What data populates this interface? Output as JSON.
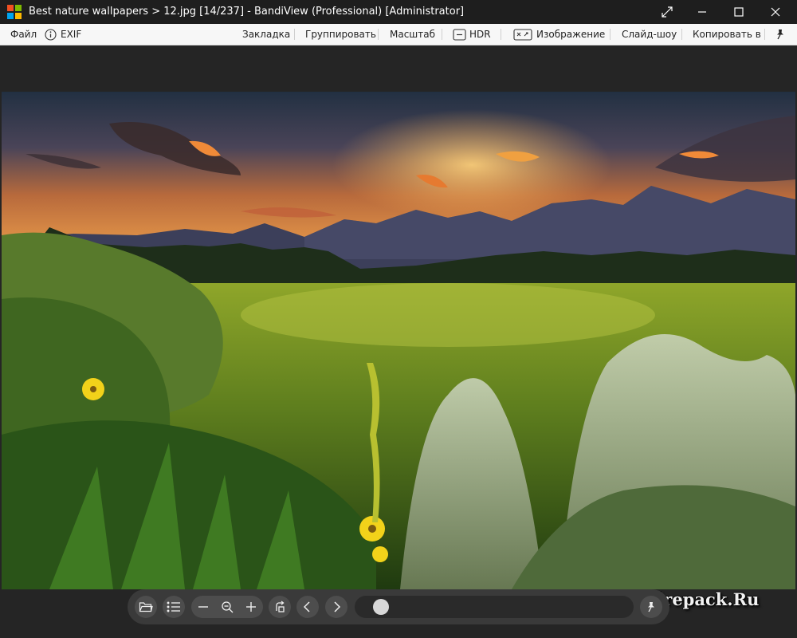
{
  "window": {
    "title": "Best nature wallpapers > 12.jpg [14/237] - BandiView (Professional) [Administrator]"
  },
  "menu": {
    "file": "Файл",
    "exif": "EXIF",
    "bookmark": "Закладка",
    "group": "Группировать",
    "scale": "Масштаб",
    "hdr": "HDR",
    "image": "Изображение",
    "slideshow": "Слайд-шоу",
    "copy_to": "Копировать в"
  },
  "image": {
    "watermark": "Allrepack.Ru"
  },
  "toolbar": {
    "slider_position": 0.05
  },
  "icons": [
    "app-logo-icon",
    "restore-icon",
    "minimize-icon",
    "maximize-icon",
    "close-icon",
    "info-icon",
    "hdr-icon",
    "image-icon",
    "pin-icon",
    "folder-icon",
    "list-icon",
    "zoom-out-icon",
    "zoom-fit-icon",
    "zoom-in-icon",
    "rotate-icon",
    "prev-icon",
    "next-icon"
  ],
  "colors": {
    "titlebar": "#1e1e1e",
    "menubar": "#f7f7f7",
    "viewer": "#252525",
    "toolbar": "#3a3a3a"
  }
}
